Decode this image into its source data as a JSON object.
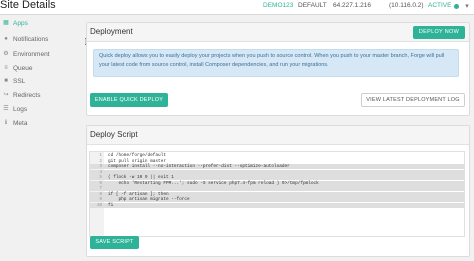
{
  "header": {
    "title": "Site Details",
    "server": "DEMO123",
    "default_label": "DEFAULT",
    "ip": "64.227.1.216",
    "private_ip": "(10.116.0.2)",
    "status": "ACTIVE",
    "status_color": "#2eb398"
  },
  "sidebar": {
    "items": [
      {
        "label": "Apps",
        "icon": "apps-icon",
        "active": true
      },
      {
        "label": "Notifications",
        "icon": "bell-icon",
        "active": false
      },
      {
        "label": "Environment",
        "icon": "environment-icon",
        "active": false
      },
      {
        "label": "Queue",
        "icon": "queue-icon",
        "active": false
      },
      {
        "label": "SSL",
        "icon": "lock-icon",
        "active": false
      },
      {
        "label": "Redirects",
        "icon": "redirect-icon",
        "active": false
      },
      {
        "label": "Logs",
        "icon": "logs-icon",
        "active": false
      },
      {
        "label": "Meta",
        "icon": "meta-icon",
        "active": false
      }
    ]
  },
  "deployment": {
    "title": "Deployment",
    "deploy_now_label": "DEPLOY NOW",
    "info_text": "Quick deploy allows you to easily deploy your projects when you push to source control. When you push to your master branch, Forge will pull your latest code from source control, install Composer dependencies, and run your migrations.",
    "quick_deploy_label": "ENABLE QUICK DEPLOY",
    "view_log_label": "VIEW LATEST DEPLOYMENT LOG"
  },
  "script": {
    "title": "Deploy Script",
    "lines": [
      {
        "num": "1",
        "text": "cd /home/forge/default",
        "selected": false
      },
      {
        "num": "2",
        "text": "git pull origin master",
        "selected": false
      },
      {
        "num": "3",
        "text": "composer install --no-interaction --prefer-dist --optimize-autoloader",
        "selected": true
      },
      {
        "num": "4",
        "text": "",
        "selected": true
      },
      {
        "num": "5",
        "text": "( flock -w 10 9 || exit 1",
        "selected": true
      },
      {
        "num": "6",
        "text": "    echo 'Restarting FPM...'; sudo -S service php7.4-fpm reload ) 9>/tmp/fpmlock",
        "selected": true
      },
      {
        "num": "7",
        "text": "",
        "selected": true
      },
      {
        "num": "8",
        "text": "if [ -f artisan ]; then",
        "selected": true
      },
      {
        "num": "9",
        "text": "    php artisan migrate --force",
        "selected": true
      },
      {
        "num": "10",
        "text": "fi",
        "selected": true
      }
    ],
    "save_label": "SAVE SCRIPT"
  },
  "colors": {
    "accent": "#2eb398",
    "info_bg": "#d6e8f5",
    "info_text": "#3b6f98"
  }
}
